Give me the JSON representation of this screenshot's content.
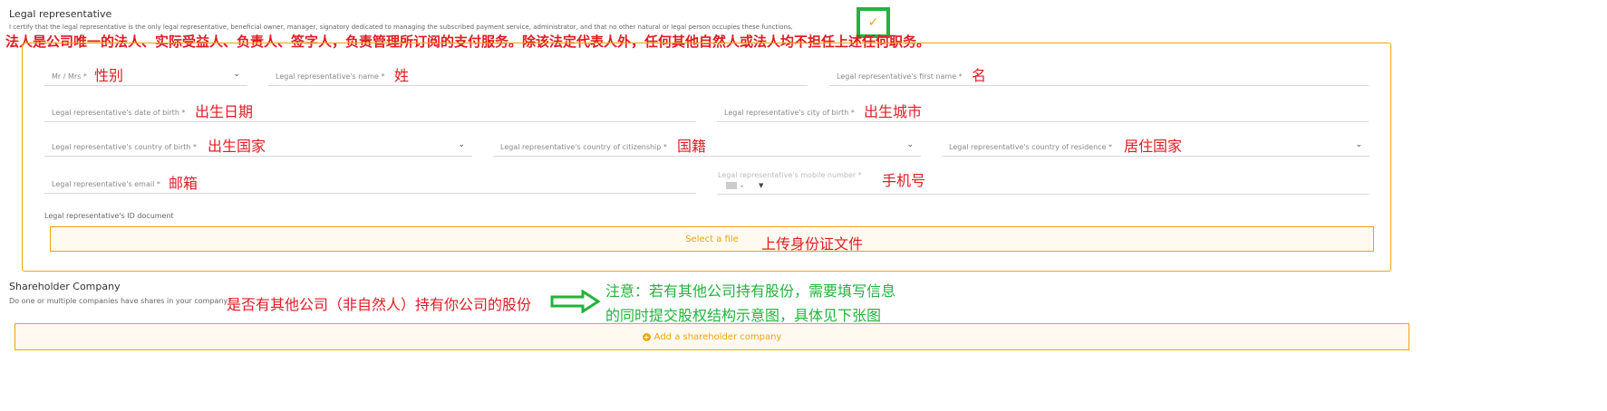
{
  "legal": {
    "title": "Legal representative",
    "certify_text": "I certify that the legal representative is the only legal representative, beneficial owner, manager, signatory dedicated to managing the subscribed payment service, administrator, and that no other natural or legal person occupies these functions.",
    "checkmark": "✓",
    "certify_annotation": "法人是公司唯一的法人、实际受益人、负责人、签字人，负责管理所订阅的支付服务。除该法定代表人外，任何其他自然人或法人均不担任上述任何职务。",
    "fields": {
      "title": {
        "label": "Mr / Mrs *",
        "annotation": "性别"
      },
      "name": {
        "label": "Legal representative's name *",
        "annotation": "姓"
      },
      "first_name": {
        "label": "Legal representative's first name *",
        "annotation": "名"
      },
      "dob": {
        "label": "Legal representative's date of birth *",
        "annotation": "出生日期"
      },
      "city_birth": {
        "label": "Legal representative's city of birth *",
        "annotation": "出生城市"
      },
      "country_birth": {
        "label": "Legal representative's country of birth *",
        "annotation": "出生国家"
      },
      "citizenship": {
        "label": "Legal representative's country of citizenship *",
        "annotation": "国籍"
      },
      "residence": {
        "label": "Legal representative's country of residence *",
        "annotation": "居住国家"
      },
      "email": {
        "label": "Legal representative's email *",
        "annotation": "邮箱"
      },
      "mobile": {
        "label": "Legal representative's mobile number *",
        "dial_prefix": "-",
        "annotation": "手机号"
      }
    },
    "id_document": {
      "label": "Legal representative's ID document",
      "button": "Select a file",
      "annotation": "上传身份证文件"
    }
  },
  "shareholder": {
    "title": "Shareholder Company",
    "question": "Do one or multiple companies have shares in your company?",
    "question_annotation": "是否有其他公司（非自然人）持有你公司的股份",
    "note_line1": "注意：若有其他公司持有股份，需要填写信息",
    "note_line2": "的同时提交股权结构示意图，具体见下张图",
    "add_button": "Add a shareholder company",
    "plus_symbol": "+"
  },
  "colors": {
    "accent_orange": "#f0a30a",
    "annotation_red": "#e01b24",
    "annotation_green": "#22b33c"
  }
}
